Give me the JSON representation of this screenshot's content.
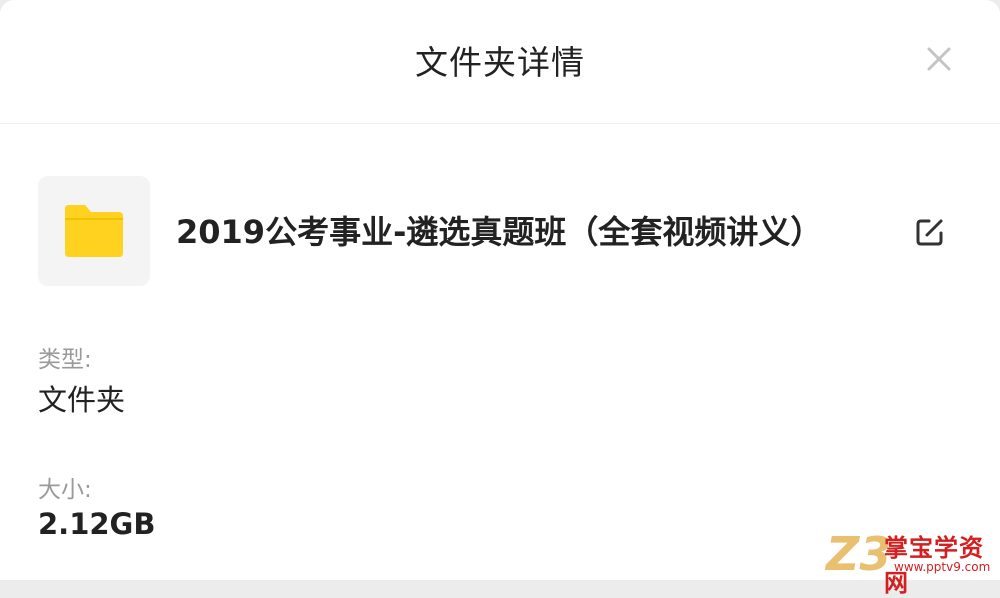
{
  "dialog": {
    "title": "文件夹详情",
    "close_icon": "close-icon"
  },
  "folder": {
    "icon": "folder-icon",
    "name": "2019公考事业-遴选真题班（全套视频讲义）",
    "edit_icon": "edit-icon"
  },
  "details": {
    "type_label": "类型:",
    "type_value": "文件夹",
    "size_label": "大小:",
    "size_value": "2.12GB"
  },
  "watermark": {
    "logo": "Z3",
    "name": "掌宝学资网",
    "url": "www.pptv9.com"
  },
  "colors": {
    "folder_yellow": "#ffd21f",
    "text_primary": "#222222",
    "text_secondary": "#9a9a9a",
    "watermark_red": "#d31f1f"
  }
}
